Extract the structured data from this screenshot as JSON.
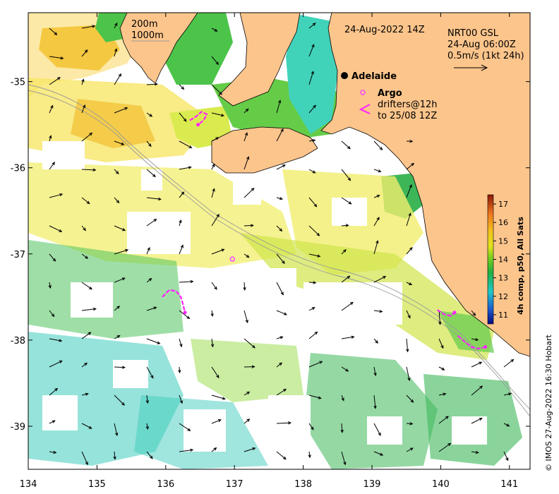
{
  "map": {
    "title": "24-Aug-2022 14Z",
    "lon_range": [
      134,
      141.3
    ],
    "lat_range": [
      -39.5,
      -34.2
    ],
    "x_ticks": [
      {
        "value": 134,
        "label": "134"
      },
      {
        "value": 135,
        "label": "135"
      },
      {
        "value": 136,
        "label": "136"
      },
      {
        "value": 137,
        "label": "137"
      },
      {
        "value": 138,
        "label": "138"
      },
      {
        "value": 139,
        "label": "139"
      },
      {
        "value": 140,
        "label": "140"
      },
      {
        "value": 141,
        "label": "141"
      }
    ],
    "y_ticks": [
      {
        "value": -35,
        "label": "-35"
      },
      {
        "value": -36,
        "label": "-36"
      },
      {
        "value": -37,
        "label": "-37"
      },
      {
        "value": -38,
        "label": "-38"
      },
      {
        "value": -39,
        "label": "-39"
      }
    ],
    "isobath_labels": [
      "200m",
      "1000m"
    ],
    "current_source": [
      "NRT00 GSL",
      "24-Aug 06:00Z",
      "0.5m/s (1kt 24h)"
    ],
    "city": {
      "name": "Adelaide",
      "lon": 138.6,
      "lat": -34.93
    },
    "argo_label": "Argo",
    "argo_float": {
      "lon": 136.97,
      "lat": -37.06
    },
    "drifter_label": [
      "drifters@12h",
      "to 25/08 12Z"
    ],
    "credit": "© IMOS 27-Aug-2022 16:30 Hobart"
  },
  "colorbar": {
    "label": "4h comp, p50, All Sats",
    "ticks": [
      "17",
      "16",
      "15",
      "14",
      "13",
      "12",
      "11"
    ],
    "range": [
      10.5,
      17.5
    ]
  },
  "colors": {
    "land": "#fcc58c",
    "argo": "#ff44ff",
    "drifter": "#ff22ff"
  },
  "drifters": [
    {
      "track": [
        [
          136.35,
          -35.45
        ],
        [
          136.45,
          -35.4
        ],
        [
          136.52,
          -35.35
        ],
        [
          136.6,
          -35.38
        ],
        [
          136.55,
          -35.45
        ],
        [
          136.47,
          -35.5
        ]
      ]
    },
    {
      "track": [
        [
          135.95,
          -37.5
        ],
        [
          136.05,
          -37.42
        ],
        [
          136.15,
          -37.43
        ],
        [
          136.22,
          -37.5
        ],
        [
          136.25,
          -37.58
        ],
        [
          136.28,
          -37.68
        ]
      ]
    },
    {
      "track": [
        [
          139.95,
          -37.65
        ],
        [
          140.05,
          -37.7
        ],
        [
          140.15,
          -37.72
        ],
        [
          140.2,
          -37.68
        ]
      ]
    },
    {
      "track": [
        [
          140.25,
          -37.95
        ],
        [
          140.35,
          -38.02
        ],
        [
          140.45,
          -38.08
        ],
        [
          140.55,
          -38.1
        ],
        [
          140.65,
          -38.08
        ]
      ]
    }
  ]
}
